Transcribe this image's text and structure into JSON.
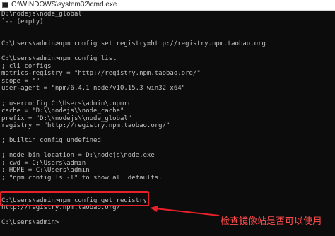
{
  "window": {
    "title": "C:\\WINDOWS\\system32\\cmd.exe",
    "icon": "cmd-icon"
  },
  "console": {
    "lines": [
      "D:\\nodejs\\node_global",
      "`-- (empty)",
      "",
      "",
      "C:\\Users\\admin>npm config set registry=http://registry.npm.taobao.org",
      "",
      "C:\\Users\\admin>npm config list",
      "; cli configs",
      "metrics-registry = \"http://registry.npm.taobao.org/\"",
      "scope = \"\"",
      "user-agent = \"npm/6.4.1 node/v10.15.3 win32 x64\"",
      "",
      "; userconfig C:\\Users\\admin\\.npmrc",
      "cache = \"D:\\\\nodejs\\\\node_cache\"",
      "prefix = \"D:\\\\nodejs\\\\node_global\"",
      "registry = \"http://registry.npm.taobao.org/\"",
      "",
      "; builtin config undefined",
      "",
      "; node bin location = D:\\nodejs\\node.exe",
      "; cwd = C:\\Users\\admin",
      "; HOME = C:\\Users\\admin",
      "; \"npm config ls -l\" to show all defaults.",
      "",
      "",
      "C:\\Users\\admin>npm config get registry",
      "http://registry.npm.taobao.org/",
      "",
      "C:\\Users\\admin>"
    ]
  },
  "annotation": {
    "text": "检查镜像站是否可以使用",
    "color": "#ff4d4d"
  },
  "highlight": {
    "color": "#e8202a"
  }
}
